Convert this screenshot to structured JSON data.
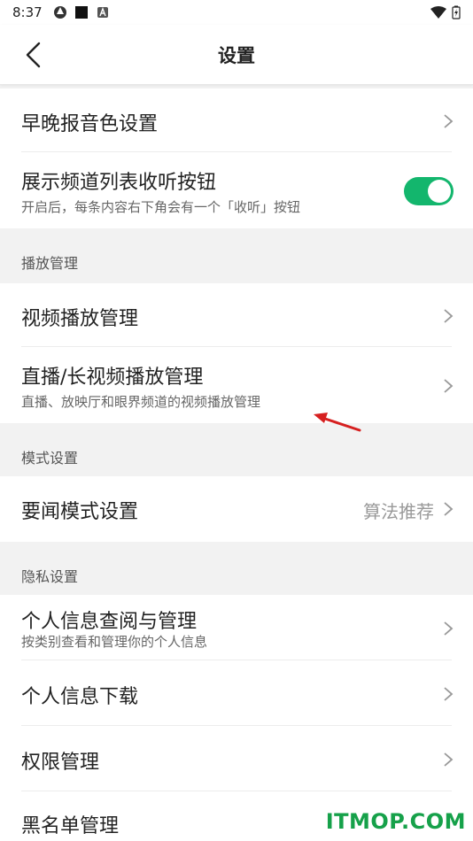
{
  "status": {
    "time": "8:37"
  },
  "header": {
    "title": "设置"
  },
  "rows": {
    "voice": {
      "title": "早晚报音色设置"
    },
    "listen_button": {
      "title": "展示频道列表收听按钮",
      "subtitle": "开启后，每条内容右下角会有一个「收听」按钮",
      "toggle_on": true
    },
    "video_play": {
      "title": "视频播放管理"
    },
    "live_play": {
      "title": "直播/长视频播放管理",
      "subtitle": "直播、放映厅和眼界频道的视频播放管理"
    },
    "news_mode": {
      "title": "要闻模式设置",
      "value": "算法推荐"
    },
    "info_review": {
      "title": "个人信息查阅与管理",
      "subtitle": "按类别查看和管理你的个人信息"
    },
    "info_download": {
      "title": "个人信息下载"
    },
    "permissions": {
      "title": "权限管理"
    },
    "blacklist": {
      "title": "黑名单管理"
    }
  },
  "sections": {
    "playback": "播放管理",
    "mode": "模式设置",
    "privacy": "隐私设置"
  },
  "watermark": "ITMOP.COM",
  "colors": {
    "accent": "#13b66d",
    "watermark": "#16a14a",
    "annotation_arrow": "#d62020"
  }
}
